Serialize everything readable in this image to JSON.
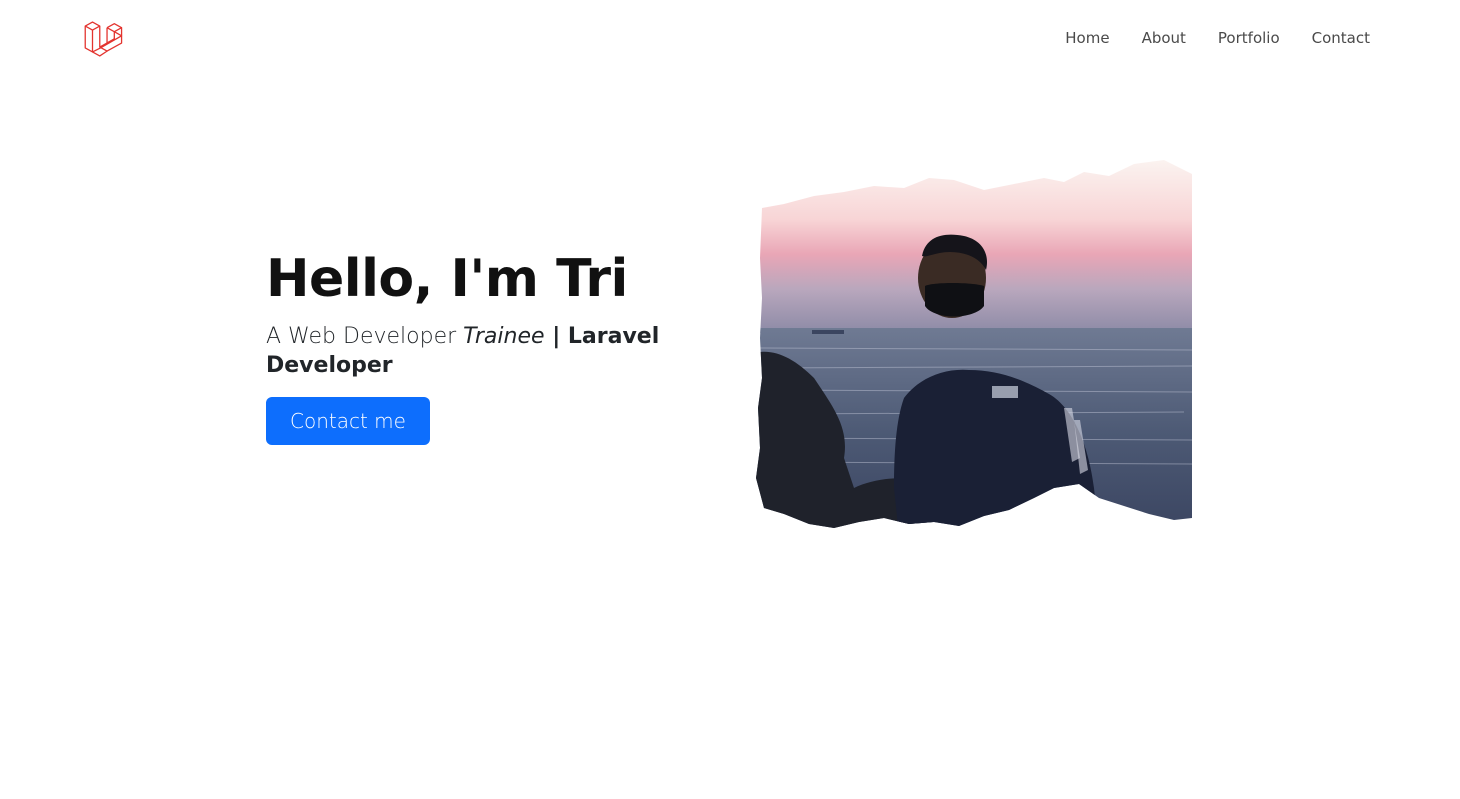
{
  "nav": {
    "logo_icon": "laravel-logo-icon",
    "items": [
      {
        "label": "Home"
      },
      {
        "label": "About"
      },
      {
        "label": "Portfolio"
      },
      {
        "label": "Contact"
      }
    ]
  },
  "hero": {
    "title": "Hello, I'm Tri",
    "subtitle_prefix": "A Web Developer ",
    "subtitle_italic": "Trainee",
    "subtitle_bar": " | ",
    "subtitle_bold": "Laravel Developer",
    "button_label": "Contact me",
    "photo_alt": "portrait-photo-by-the-sea-at-sunset"
  },
  "colors": {
    "accent": "#0d6efd",
    "logo": "#e3342f",
    "nav_text": "#4a4a4a",
    "title_text": "#111111"
  }
}
